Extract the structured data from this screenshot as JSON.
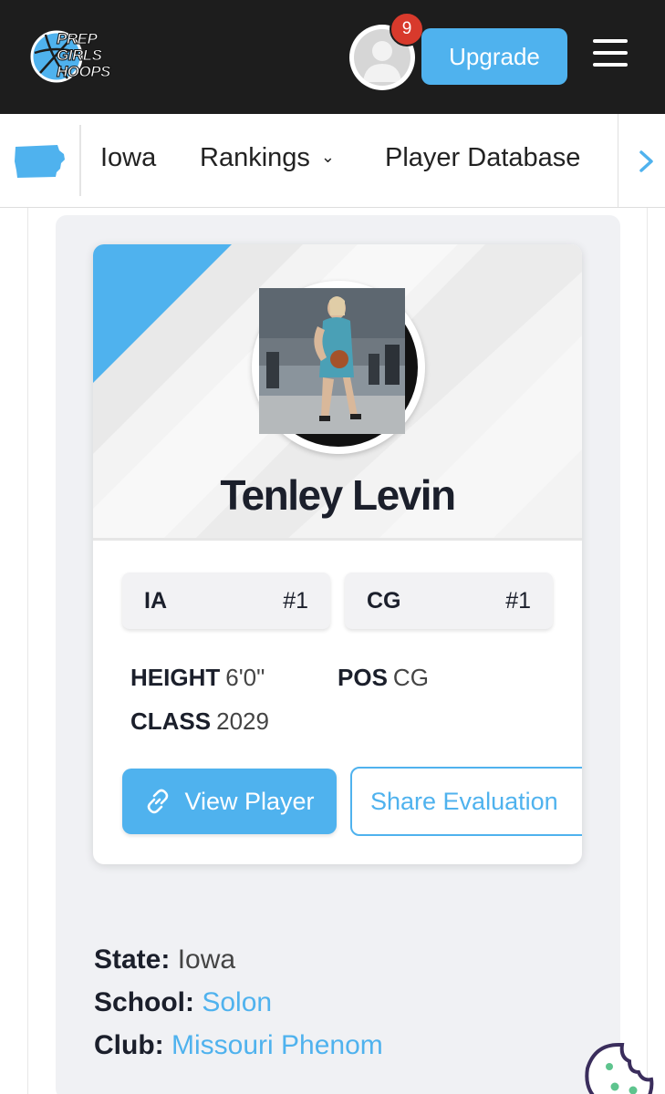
{
  "header": {
    "logo_lines": [
      "PREP",
      "GIRLS",
      "HOOPS"
    ],
    "notification_count": "9",
    "upgrade_label": "Upgrade",
    "icons": {
      "avatar": "user-avatar-icon",
      "menu": "hamburger-menu-icon"
    }
  },
  "subnav": {
    "state_icon": "iowa-state-icon",
    "items": [
      {
        "label": "Iowa"
      },
      {
        "label": "Rankings",
        "has_dropdown": true
      },
      {
        "label": "Player Database"
      }
    ]
  },
  "player": {
    "name": "Tenley Levin",
    "rankings": [
      {
        "label": "IA",
        "value": "#1"
      },
      {
        "label": "CG",
        "value": "#1"
      }
    ],
    "attributes": {
      "height_label": "HEIGHT",
      "height_value": "6'0\"",
      "pos_label": "POS",
      "pos_value": "CG",
      "class_label": "CLASS",
      "class_value": "2029"
    },
    "view_button": "View Player",
    "share_button": "Share Evaluation"
  },
  "details": {
    "state_label": "State:",
    "state_value": "Iowa",
    "school_label": "School:",
    "school_value": "Solon",
    "club_label": "Club:",
    "club_value": "Missouri Phenom"
  },
  "colors": {
    "accent": "#4fb2ee",
    "header_bg": "#1d1d1d",
    "badge": "#d83a2c",
    "text_dark": "#1b1f2b"
  }
}
